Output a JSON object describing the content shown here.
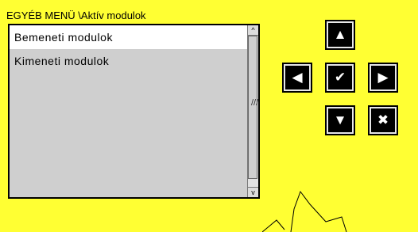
{
  "header": {
    "title": "EGYÉB MENÜ \\Aktív modulok"
  },
  "menu": {
    "items": [
      {
        "label": "Bemeneti modulok",
        "selected": true
      },
      {
        "label": "Kimeneti modulok",
        "selected": false
      }
    ]
  },
  "scrollbar": {
    "up_glyph": "^",
    "down_glyph": "v",
    "grip_glyph": "///"
  },
  "keypad": {
    "up": "▲",
    "left": "◀",
    "ok": "✔",
    "right": "▶",
    "down": "▼",
    "cancel": "✖"
  },
  "colors": {
    "background": "#ffff33",
    "panel": "#cfcfcf",
    "selected": "#ffffff",
    "button": "#000000"
  }
}
